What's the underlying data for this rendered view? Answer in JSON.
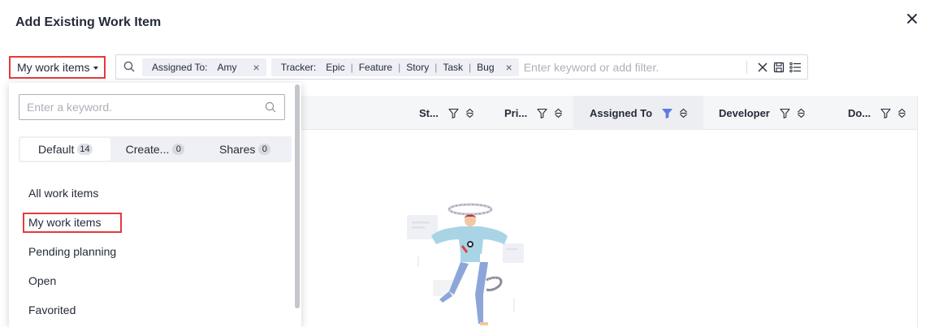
{
  "dialog": {
    "title": "Add Existing Work Item"
  },
  "view_select": {
    "label": "My work items"
  },
  "filter_bar": {
    "tags": [
      {
        "key": "Assigned To:",
        "values": [
          "Amy"
        ]
      },
      {
        "key": "Tracker:",
        "values": [
          "Epic",
          "Feature",
          "Story",
          "Task",
          "Bug"
        ]
      }
    ],
    "placeholder": "Enter keyword or add filter.",
    "tag_separator": "|",
    "tag_remove": "×"
  },
  "table": {
    "columns": [
      {
        "label": "St..."
      },
      {
        "label": "Pri..."
      },
      {
        "label": "Assigned To",
        "filtered": true
      },
      {
        "label": "Developer"
      },
      {
        "label": "Do..."
      }
    ],
    "filter_active_color": "#5e7ce0"
  },
  "dropdown": {
    "search_placeholder": "Enter a keyword.",
    "tabs": [
      {
        "label": "Default",
        "count": "14"
      },
      {
        "label": "Create...",
        "count": "0"
      },
      {
        "label": "Shares",
        "count": "0"
      }
    ],
    "items": [
      {
        "label": "All work items"
      },
      {
        "label": "My work items",
        "highlighted": true
      },
      {
        "label": "Pending planning"
      },
      {
        "label": "Open"
      },
      {
        "label": "Favorited"
      }
    ]
  },
  "colors": {
    "annotation_red": "#e23c3c",
    "text": "#252b3a",
    "placeholder": "#adb0b8"
  }
}
